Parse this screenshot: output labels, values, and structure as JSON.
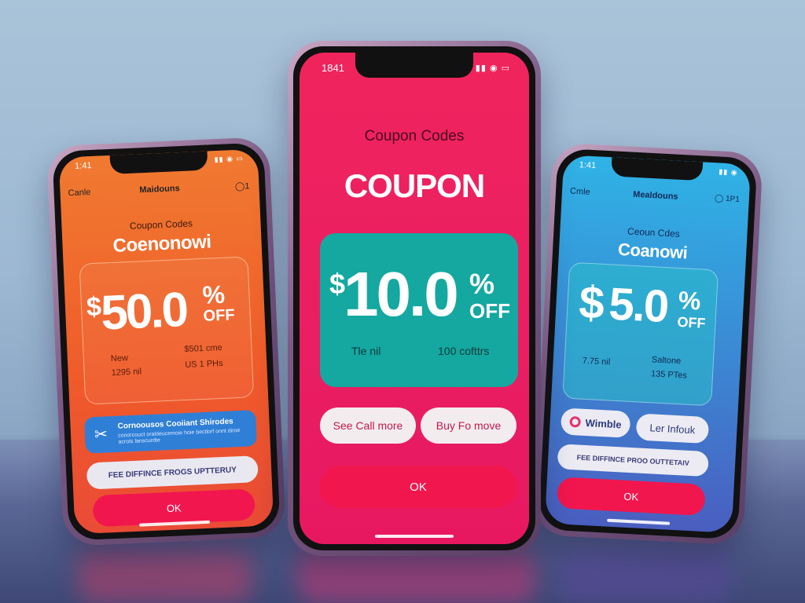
{
  "left_phone": {
    "status_time": "1:41",
    "status_icons": "▮▮ ◉ ▭",
    "nav_back": "Canle",
    "nav_title": "Maidouns",
    "nav_action": "◯1",
    "subtitle": "Coupon Codes",
    "brand": "Coenonowi",
    "deal": {
      "currency": "$",
      "amount": "50.0",
      "percent": "%",
      "off": "OFF"
    },
    "info": {
      "left_top": "New",
      "left_bottom": "1295 nil",
      "right_top": "$501 cme",
      "right_bottom": "US 1 PHs"
    },
    "promo_title": "Cornoousos Cooiiant Shirodes",
    "promo_sub": "conorcouct oraldeucemoie hoie bectlorf onnt diroe acrots lanscurdte",
    "free_text": "FEE DIFFINCE FROGS UPTTERUY",
    "ok_label": "OK"
  },
  "center_phone": {
    "status_time": "1841",
    "status_icons": "▮▮ ◉ ▭",
    "subtitle": "Coupon Codes",
    "title": "COUPON",
    "deal": {
      "currency": "$",
      "amount": "10.0",
      "percent": "%",
      "off": "OFF"
    },
    "info_left": "Tle nil",
    "info_right": "100 cofttrs",
    "see_button": "See Call more",
    "buy_button": "Buy Fo move",
    "ok_label": "OK"
  },
  "right_phone": {
    "status_time": "1:41",
    "status_icons": "▮▮ ◉",
    "nav_back": "Cmle",
    "nav_title": "Mealdouns",
    "nav_action": "◯ 1P1",
    "subtitle": "Ceoun Cdes",
    "brand": "Coanowi",
    "deal": {
      "currency": "$",
      "amount": "5.0",
      "percent": "%",
      "off": "OFF"
    },
    "info": {
      "left": "7.75 nil",
      "right_top": "Saltone",
      "right_bottom": "135 PTes"
    },
    "wimble_button": "Wimble",
    "link_button": "Ler Infouk",
    "free_text": "FEE DIFFINCE PROO OUTTETAIV",
    "ok_label": "OK"
  },
  "colors": {
    "center_bg": "#e91e63",
    "teal_card": "#14a8a0",
    "ok_red": "#f2164e",
    "left_bg": "#f06a2c",
    "right_bg": "#3a8ad4"
  }
}
